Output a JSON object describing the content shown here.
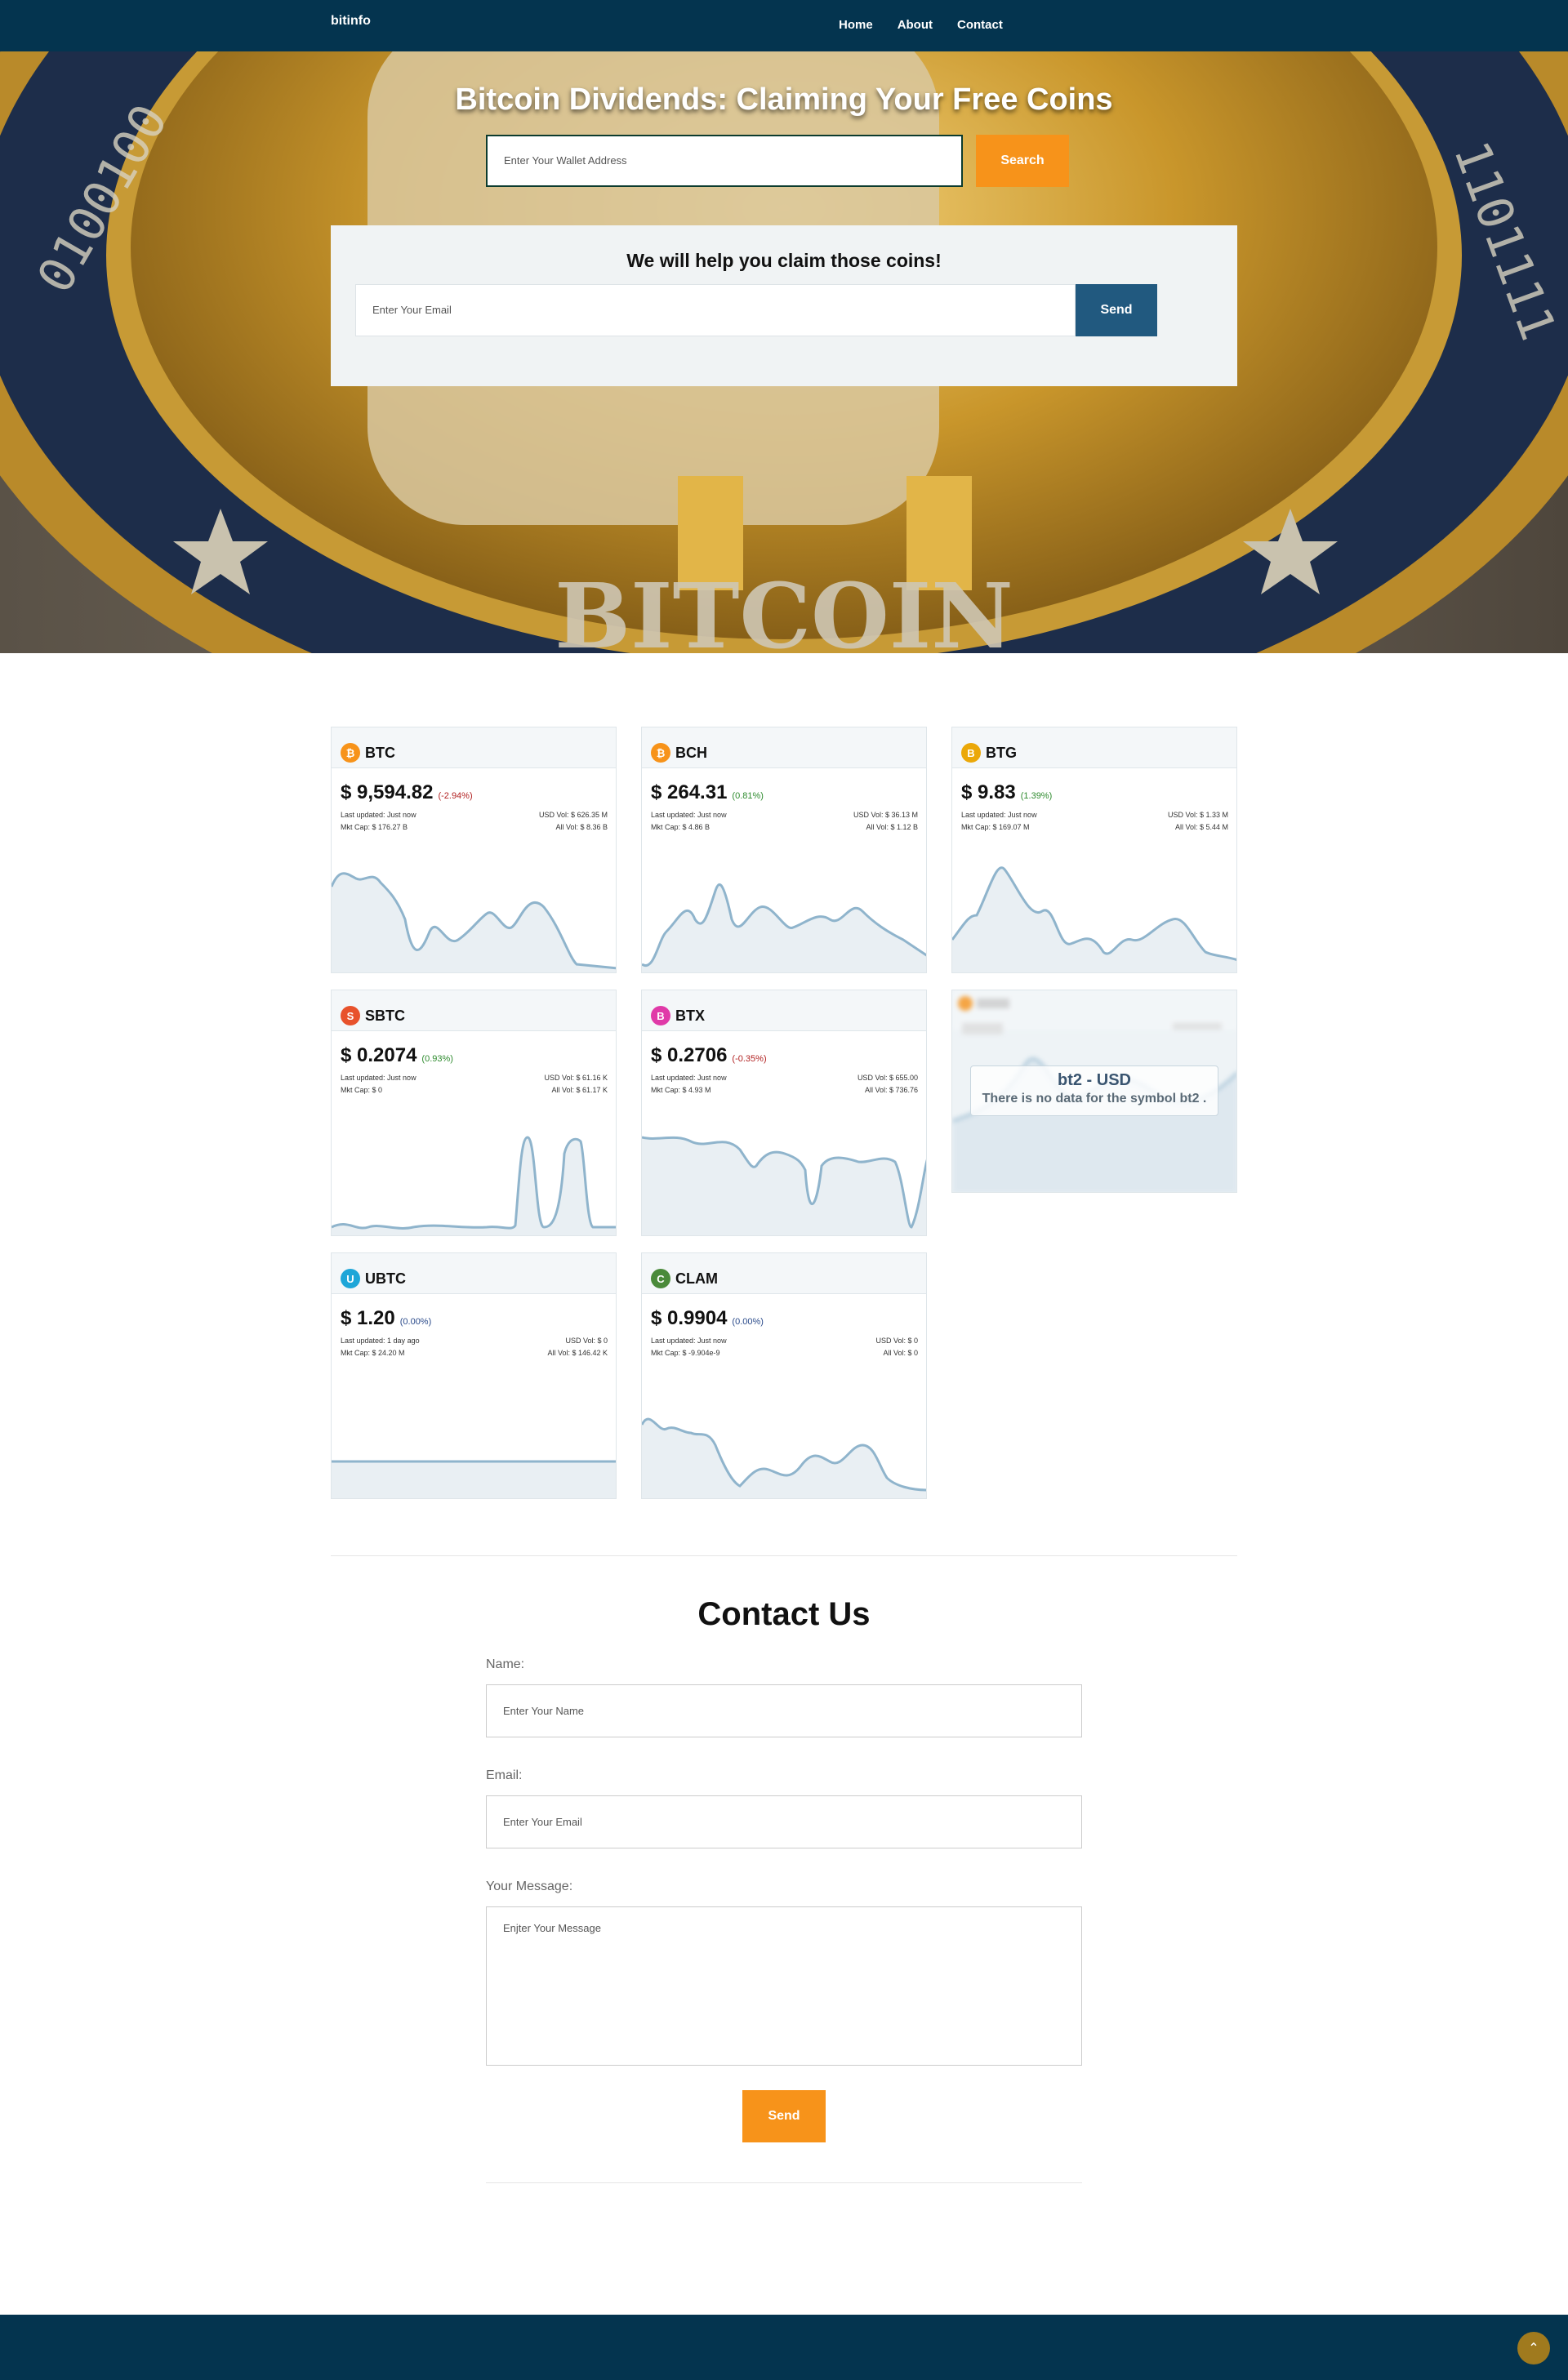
{
  "nav": {
    "brand": "bitinfo",
    "links": [
      "Home",
      "About",
      "Contact"
    ]
  },
  "hero": {
    "title": "Bitcoin Dividends: Claiming Your Free Coins",
    "wallet_placeholder": "Enter Your Wallet Address",
    "search_label": "Search",
    "panel_heading": "We will help you claim those coins!",
    "email_placeholder": "Enter Your Email",
    "send_label": "Send"
  },
  "coins": [
    {
      "symbol": "BTC",
      "price": "$ 9,594.82",
      "change": "(-2.94%)",
      "trend": "neg",
      "updated": "Last updated: Just now",
      "mktcap": "Mkt Cap: $ 176.27 B",
      "usdvol": "USD Vol: $ 626.35 M",
      "allvol": "All Vol: $ 8.36 B",
      "icon_color": "#f7931a",
      "icon_glyph": "₿"
    },
    {
      "symbol": "BCH",
      "price": "$ 264.31",
      "change": "(0.81%)",
      "trend": "pos",
      "updated": "Last updated: Just now",
      "mktcap": "Mkt Cap: $ 4.86 B",
      "usdvol": "USD Vol: $ 36.13 M",
      "allvol": "All Vol: $ 1.12 B",
      "icon_color": "#f7931a",
      "icon_glyph": "₿"
    },
    {
      "symbol": "BTG",
      "price": "$ 9.83",
      "change": "(1.39%)",
      "trend": "pos",
      "updated": "Last updated: Just now",
      "mktcap": "Mkt Cap: $ 169.07 M",
      "usdvol": "USD Vol: $ 1.33 M",
      "allvol": "All Vol: $ 5.44 M",
      "icon_color": "#eba809",
      "icon_glyph": "B"
    },
    {
      "symbol": "SBTC",
      "price": "$ 0.2074",
      "change": "(0.93%)",
      "trend": "pos",
      "updated": "Last updated: Just now",
      "mktcap": "Mkt Cap: $ 0",
      "usdvol": "USD Vol: $ 61.16 K",
      "allvol": "All Vol: $ 61.17 K",
      "icon_color": "#e8522c",
      "icon_glyph": "S"
    },
    {
      "symbol": "BTX",
      "price": "$ 0.2706",
      "change": "(-0.35%)",
      "trend": "neg",
      "updated": "Last updated: Just now",
      "mktcap": "Mkt Cap: $ 4.93 M",
      "usdvol": "USD Vol: $ 655.00",
      "allvol": "All Vol: $ 736.76",
      "icon_color": "#e03aa8",
      "icon_glyph": "B"
    },
    {
      "symbol": "UBTC",
      "price": "$ 1.20",
      "change": "(0.00%)",
      "trend": "neu",
      "updated": "Last updated: 1 day ago",
      "mktcap": "Mkt Cap: $ 24.20 M",
      "usdvol": "USD Vol: $ 0",
      "allvol": "All Vol: $ 146.42 K",
      "icon_color": "#1ea6d8",
      "icon_glyph": "U"
    },
    {
      "symbol": "CLAM",
      "price": "$ 0.9904",
      "change": "(0.00%)",
      "trend": "neu",
      "updated": "Last updated: Just now",
      "mktcap": "Mkt Cap: $ -9.904e-9",
      "usdvol": "USD Vol: $ 0",
      "allvol": "All Vol: $ 0",
      "icon_color": "#4a8a3a",
      "icon_glyph": "C"
    }
  ],
  "bt2": {
    "title": "bt2 - USD",
    "message": "There is no data for the symbol bt2 ."
  },
  "contact": {
    "title": "Contact Us",
    "name_label": "Name:",
    "name_placeholder": "Enter Your Name",
    "email_label": "Email:",
    "email_placeholder": "Enter Your Email",
    "message_label": "Your Message:",
    "message_placeholder": "Enjter Your Message",
    "send_label": "Send"
  },
  "colors": {
    "nav_bg": "#04344f",
    "accent_orange": "#f7931a",
    "send_blue": "#21597f",
    "sparkline": "#8fb4cc"
  }
}
